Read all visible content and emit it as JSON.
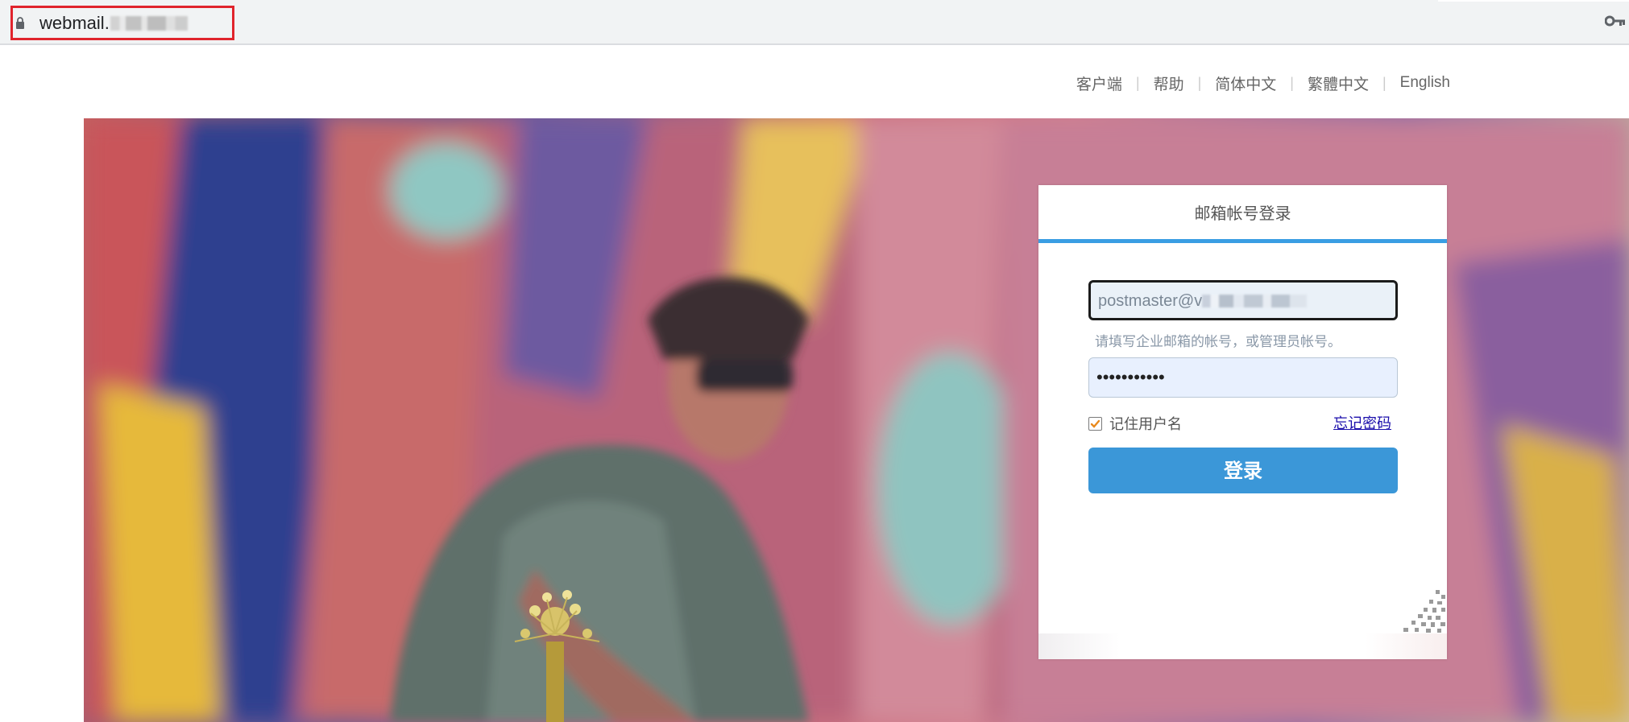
{
  "browser": {
    "url_prefix": "webmail.",
    "icons": {
      "lock": "lock-icon",
      "key": "key-icon"
    }
  },
  "topnav": {
    "items": [
      {
        "label": "客户端"
      },
      {
        "label": "帮助"
      },
      {
        "label": "简体中文"
      },
      {
        "label": "繁體中文"
      },
      {
        "label": "English"
      }
    ]
  },
  "login": {
    "title": "邮箱帐号登录",
    "username_value": "postmaster@v",
    "hint": "请填写企业邮箱的帐号，或管理员帐号。",
    "password_value": "•••••••••••",
    "remember_label": "记住用户名",
    "remember_checked": true,
    "forgot_label": "忘记密码",
    "submit_label": "登录",
    "qr_icon": "qr-code-icon"
  },
  "colors": {
    "accent": "#3a9ee3",
    "button": "#3b97d8",
    "highlight_box": "#e0242c",
    "checkbox_check": "#e8891c"
  }
}
